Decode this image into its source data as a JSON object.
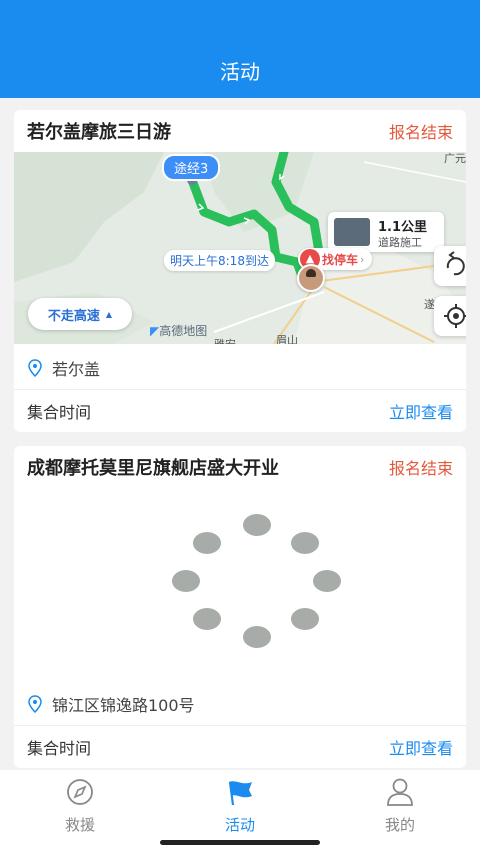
{
  "header": {
    "title": "活动"
  },
  "activities": [
    {
      "title": "若尔盖摩旅三日游",
      "status": "报名结束",
      "location": "若尔盖",
      "time_label": "集合时间",
      "view_link": "立即查看",
      "map": {
        "waypoint_label": "途经3",
        "distance": "1.1公里",
        "incident": "道路施工",
        "find_parking": "找停车",
        "arrival": "明天上午8:18到达",
        "avoid_highway": "不走高速",
        "watermark": "高德地图",
        "place_guangyuan": "广元",
        "place_sui": "遂",
        "place_meishan": "眉山",
        "place_yaan": "雅安"
      }
    },
    {
      "title": "成都摩托莫里尼旗舰店盛大开业",
      "status": "报名结束",
      "location": "锦江区锦逸路100号",
      "time_label": "集合时间",
      "view_link": "立即查看"
    }
  ],
  "tabs": [
    {
      "label": "救援",
      "icon": "compass-icon",
      "active": false
    },
    {
      "label": "活动",
      "icon": "flag-icon",
      "active": true
    },
    {
      "label": "我的",
      "icon": "user-icon",
      "active": false
    }
  ],
  "colors": {
    "primary": "#1a8cf0",
    "status": "#e25a3c",
    "route": "#2bbf5c"
  }
}
